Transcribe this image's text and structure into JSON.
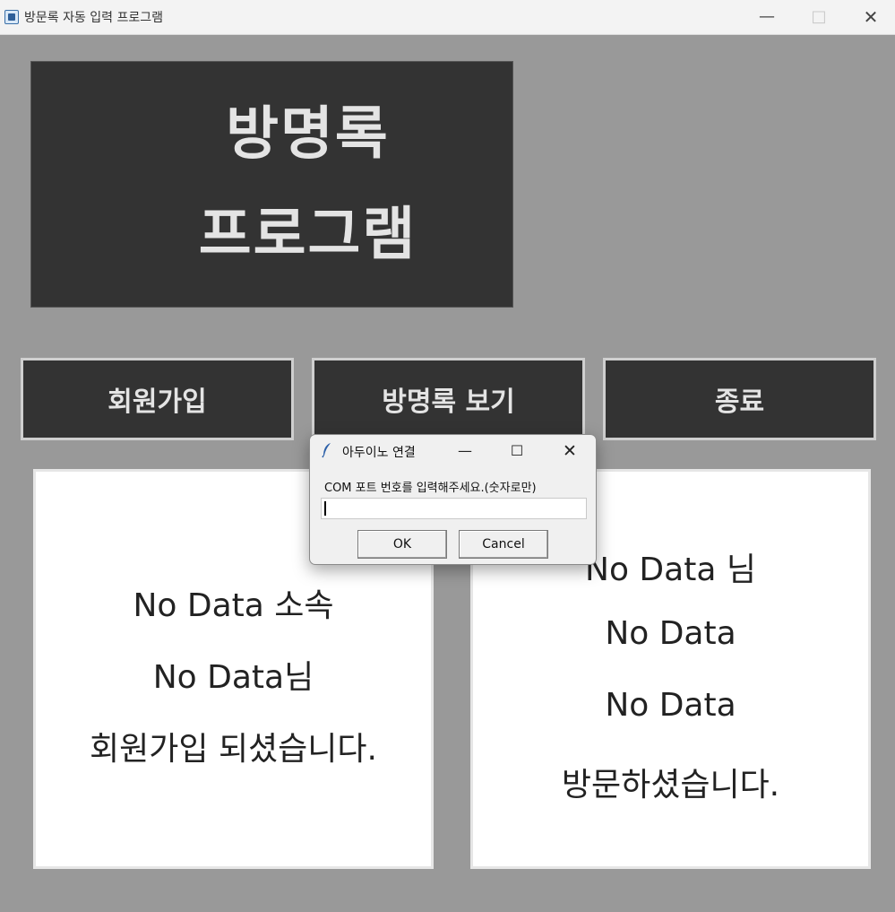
{
  "window": {
    "title": "방문록 자동 입력 프로그램",
    "minimize": "—",
    "maximize": "□",
    "close": "✕"
  },
  "header": {
    "line1": "방명록",
    "line2": "프로그램"
  },
  "buttons": {
    "signup": "회원가입",
    "view_guestbook": "방명록 보기",
    "exit": "종료"
  },
  "left_panel": {
    "line1": "No Data 소속",
    "line2": "No Data님",
    "line3": "회원가입 되셨습니다."
  },
  "right_panel": {
    "line1": "No Data 님",
    "line2": "No Data",
    "line3": "No Data",
    "line4": "방문하셨습니다."
  },
  "dialog": {
    "title": "아두이노 연결",
    "minimize": "—",
    "maximize": "☐",
    "close": "✕",
    "prompt": "COM 포트 번호를 입력해주세요.(숫자로만)",
    "input_value": "",
    "ok": "OK",
    "cancel": "Cancel"
  },
  "colors": {
    "background": "#999999",
    "dark_block": "#333333",
    "light_text": "#e4e4e4"
  }
}
